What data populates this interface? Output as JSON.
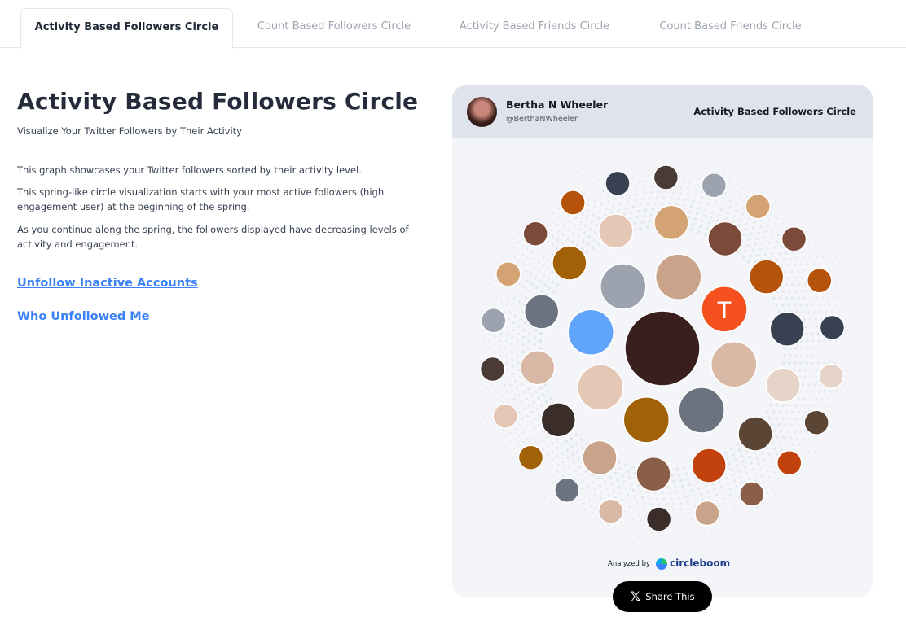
{
  "tabs": [
    {
      "label": "Activity Based Followers Circle",
      "active": true
    },
    {
      "label": "Count Based Followers Circle",
      "active": false
    },
    {
      "label": "Activity Based Friends Circle",
      "active": false
    },
    {
      "label": "Count Based Friends Circle",
      "active": false
    }
  ],
  "main": {
    "title": "Activity Based Followers Circle",
    "subtitle": "Visualize Your Twitter Followers by Their Activity",
    "paragraphs": [
      "This graph showcases your Twitter followers sorted by their activity level.",
      "This spring-like circle visualization starts with your most active followers (high engagement user) at the beginning of the spring.",
      "As you continue along the spring, the followers displayed have decreasing levels of activity and engagement."
    ],
    "links": [
      "Unfollow Inactive Accounts",
      "Who Unfollowed Me"
    ]
  },
  "card": {
    "user_name": "Bertha N Wheeler",
    "user_handle": "@BerthaNWheeler",
    "title": "Activity Based Followers Circle",
    "analyzed_by": "Analyzed by",
    "brand": "circleboom",
    "avatar_letter": "T",
    "colors": {
      "accent_orange": "#f4511e",
      "header_bg": "#dfe4ec",
      "card_bg": "#f3f5f9"
    }
  },
  "share": {
    "label": "Share This",
    "icon": "x-logo-icon"
  }
}
